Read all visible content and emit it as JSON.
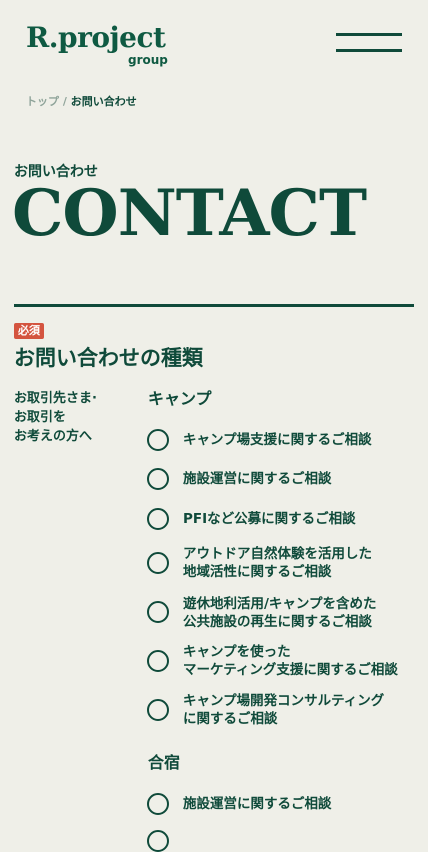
{
  "header": {
    "logo_main": "R.project",
    "logo_sub": "group",
    "menu_label": "menu"
  },
  "breadcrumb": {
    "home": "トップ",
    "separator": "/",
    "current": "お問い合わせ"
  },
  "page": {
    "subtitle": "お問い合わせ",
    "title": "CONTACT"
  },
  "form": {
    "required_label": "必須",
    "heading": "お問い合わせの種類",
    "side_note": "お取引先さま·\nお取引を\nお考えの方へ",
    "groups": [
      {
        "label": "キャンプ",
        "options": [
          "キャンプ場支援に関するご相談",
          "施設運営に関するご相談",
          "PFIなど公募に関するご相談",
          "アウトドア自然体験を活用した\n地域活性に関するご相談",
          "遊休地利活用/キャンプを含めた\n公共施設の再生に関するご相談",
          "キャンプを使った\nマーケティング支援に関するご相談",
          "キャンプ場開発コンサルティング\nに関するご相談"
        ]
      },
      {
        "label": "合宿",
        "options": [
          "施設運営に関するご相談"
        ]
      }
    ]
  },
  "colors": {
    "primary": "#0f4a3a",
    "background": "#efefe8",
    "badge": "#d4543f"
  }
}
